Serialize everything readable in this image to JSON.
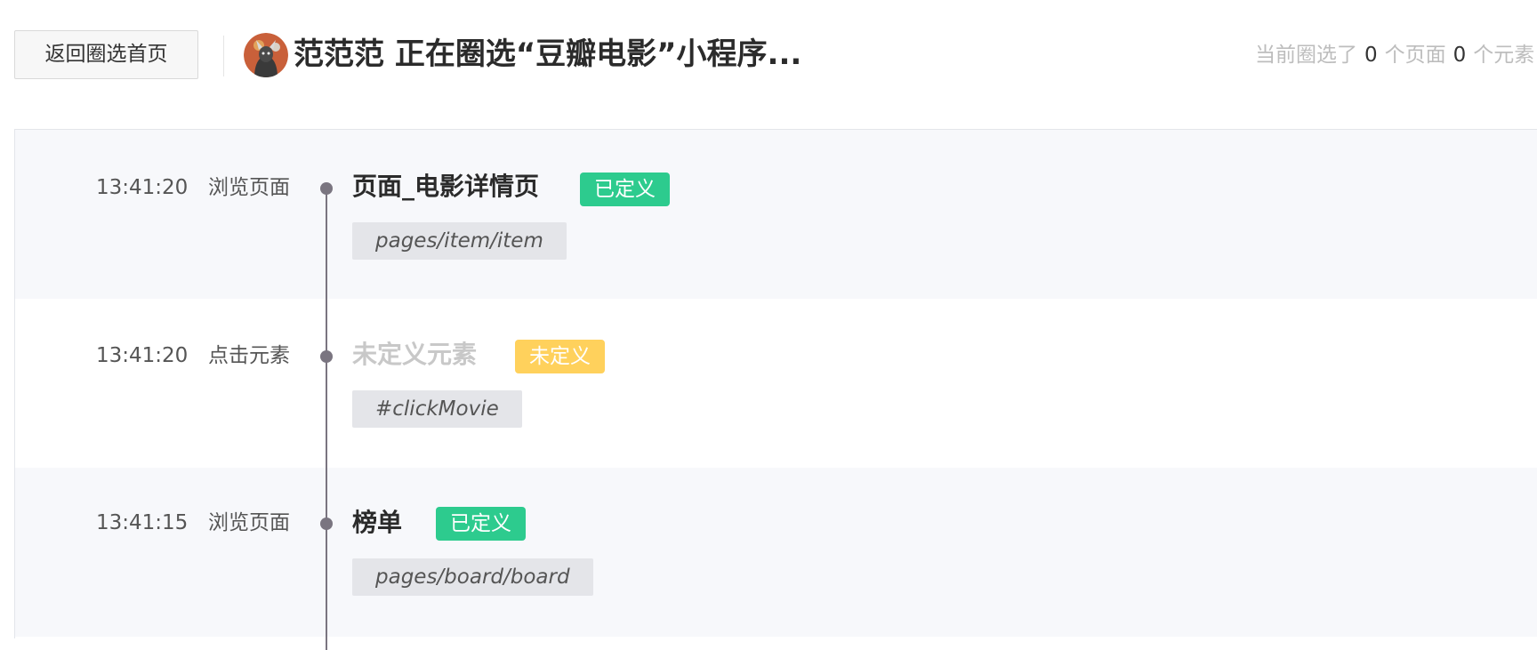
{
  "header": {
    "back_button_label": "返回圈选首页",
    "title": "范范范 正在圈选“豆瓣电影”小程序...",
    "summary_prefix": "当前圈选了",
    "page_count": "0",
    "page_unit": "个页面",
    "element_count": "0",
    "element_unit": "个元素"
  },
  "colors": {
    "defined_badge": "#2dcb8e",
    "undefined_badge": "#ffd15c",
    "timeline": "#7a7580"
  },
  "events": [
    {
      "time": "13:41:20",
      "type": "浏览页面",
      "name": "页面_电影详情页",
      "status": "已定义",
      "path": "pages/item/item"
    },
    {
      "time": "13:41:20",
      "type": "点击元素",
      "name": "未定义元素",
      "status": "未定义",
      "path": "#clickMovie"
    },
    {
      "time": "13:41:15",
      "type": "浏览页面",
      "name": "榜单",
      "status": "已定义",
      "path": "pages/board/board"
    }
  ]
}
